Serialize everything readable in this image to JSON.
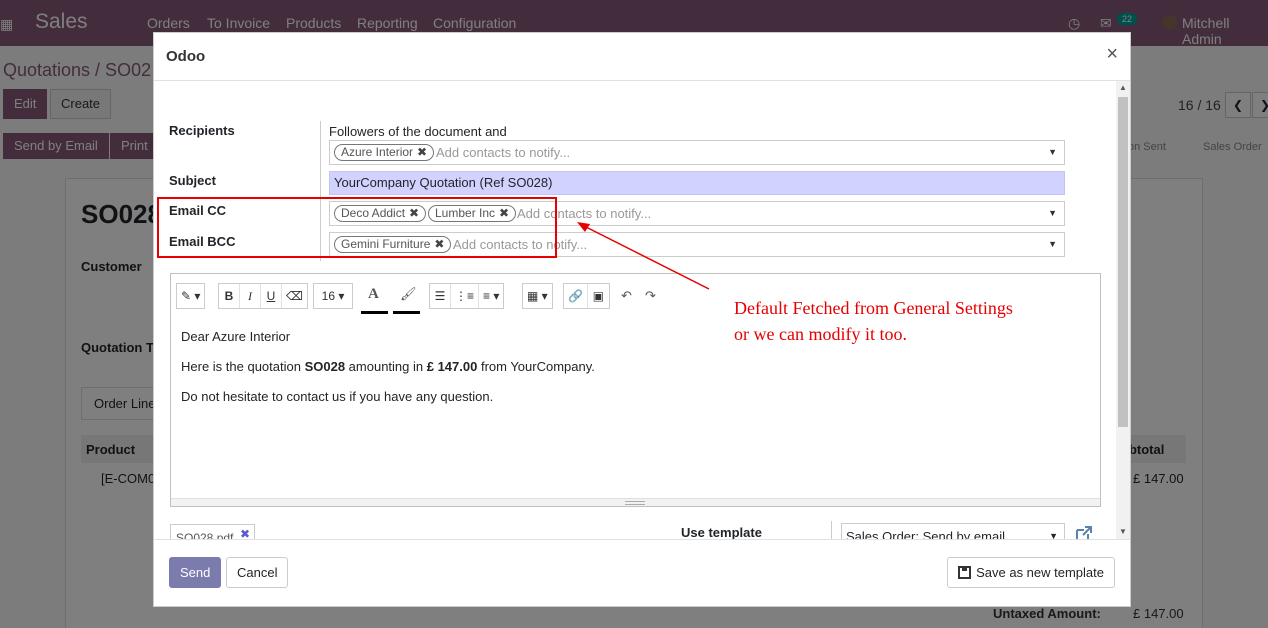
{
  "navbar": {
    "apps_icon": "grid-icon",
    "brand": "Sales",
    "menu": [
      "Orders",
      "To Invoice",
      "Products",
      "Reporting",
      "Configuration"
    ],
    "messages_badge": "22",
    "user": "Mitchell Admin"
  },
  "background": {
    "breadcrumb": "Quotations / SO02",
    "edit_label": "Edit",
    "create_label": "Create",
    "send_by_email_label": "Send by Email",
    "print_label": "Print",
    "pager": "16 / 16",
    "status_sent": "on Sent",
    "status_sales_order": "Sales Order",
    "title": "SO028",
    "customer_label": "Customer",
    "quotation_label": "Quotation T",
    "order_lines_tab": "Order Line",
    "col_product": "Product",
    "col_subtotal": "ubtotal",
    "row_product": "[E-COM0",
    "row_subtotal": "£ 147.00",
    "untaxed_label": "Untaxed Amount:",
    "untaxed_value": "£ 147.00"
  },
  "modal": {
    "title": "Odoo",
    "close_icon": "close-icon",
    "recipients_label": "Recipients",
    "followers_text": "Followers of the document and",
    "recipients_tags": [
      "Azure Interior"
    ],
    "contacts_placeholder": "Add contacts to notify...",
    "subject_label": "Subject",
    "subject_value": "YourCompany Quotation (Ref SO028)",
    "email_cc_label": "Email CC",
    "cc_tags": [
      "Deco Addict",
      "Lumber Inc"
    ],
    "email_bcc_label": "Email BCC",
    "bcc_tags": [
      "Gemini Furniture"
    ],
    "font_size": "16",
    "body": {
      "greeting": "Dear Azure Interior",
      "line2_pre": "Here is the quotation ",
      "line2_ref": "SO028",
      "line2_mid": " amounting in ",
      "line2_amount": "£ 147.00",
      "line2_post": " from YourCompany.",
      "line3": "Do not hesitate to contact us if you have any question."
    },
    "attachment": "SO028.pdf",
    "use_template_label": "Use template",
    "template_value": "Sales Order: Send by email",
    "send_label": "Send",
    "cancel_label": "Cancel",
    "save_template_label": "Save as new template"
  },
  "annotation": {
    "line1": "Default Fetched from General Settings",
    "line2": "or we can modify it too.",
    "color": "#e60000"
  },
  "colors": {
    "navbar": "#875a7b",
    "primary_button": "#7c7bad",
    "subject_bg": "#d2d2ff"
  }
}
